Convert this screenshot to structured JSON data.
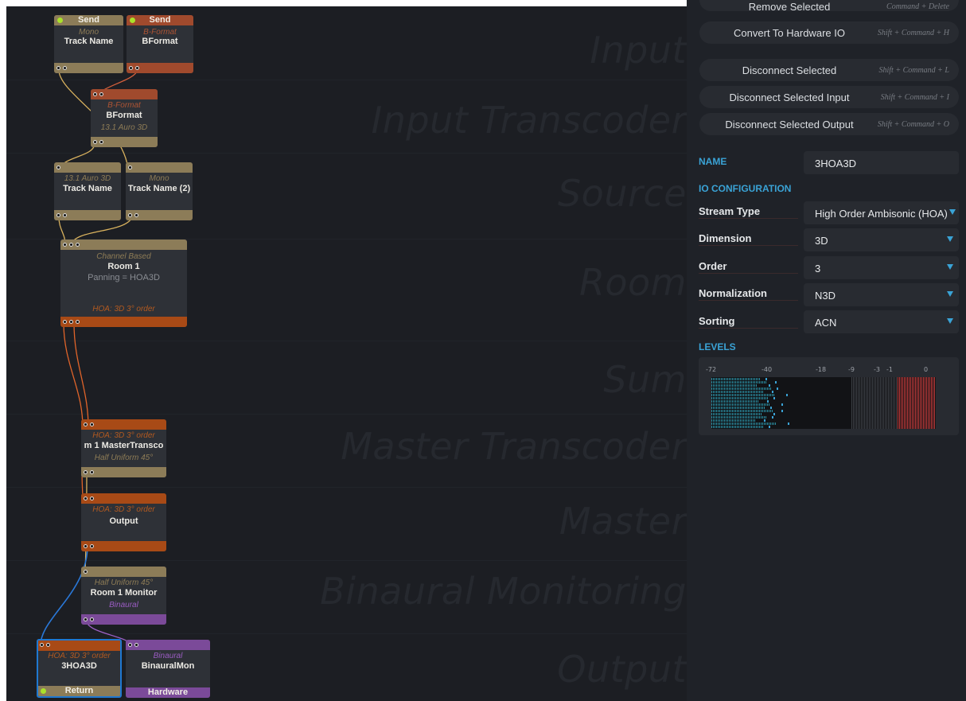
{
  "stages": [
    "Input",
    "Input Transcoder",
    "Source",
    "Room",
    "Sum",
    "Master Transcoder",
    "Master",
    "Binaural Monitoring",
    "Output"
  ],
  "nodes": {
    "send_mono": {
      "header": "Send",
      "format": "Mono",
      "name": "Track Name"
    },
    "send_bformat": {
      "header": "Send",
      "format": "B-Format",
      "name": "BFormat"
    },
    "bformat_transcoder": {
      "format": "B-Format",
      "name": "BFormat",
      "output_format": "13.1 Auro 3D"
    },
    "track_auro": {
      "format": "13.1 Auro 3D",
      "name": "Track Name"
    },
    "track_mono2": {
      "format": "Mono",
      "name": "Track Name (2)"
    },
    "room1": {
      "format": "Channel Based",
      "name": "Room 1",
      "info": "Panning = HOA3D",
      "output_format": "HOA: 3D 3° order"
    },
    "master_transcoder": {
      "format": "HOA: 3D 3° order",
      "name": "m 1 MasterTransco",
      "output_format": "Half Uniform 45°"
    },
    "output": {
      "format": "HOA: 3D 3° order",
      "name": "Output"
    },
    "monitor": {
      "format": "Half Uniform 45°",
      "name": "Room 1 Monitor",
      "output_format": "Binaural"
    },
    "return_3hoa": {
      "format": "HOA: 3D 3° order",
      "name": "3HOA3D",
      "footer": "Return"
    },
    "binauralmon": {
      "format": "Binaural",
      "name": "BinauralMon",
      "footer": "Hardware"
    }
  },
  "panel": {
    "commands": [
      {
        "label": "Remove Selected",
        "shortcut": "Command + Delete"
      },
      {
        "label": "Convert To Hardware IO",
        "shortcut": "Shift + Command + H"
      },
      {
        "label": "Disconnect Selected",
        "shortcut": "Shift + Command + L"
      },
      {
        "label": "Disconnect Selected Input",
        "shortcut": "Shift + Command + I"
      },
      {
        "label": "Disconnect Selected Output",
        "shortcut": "Shift + Command + O"
      }
    ],
    "name_label": "NAME",
    "name_value": "3HOA3D",
    "io_label": "IO CONFIGURATION",
    "fields": [
      {
        "label": "Stream Type",
        "value": "High Order Ambisonic (HOA)"
      },
      {
        "label": "Dimension",
        "value": "3D"
      },
      {
        "label": "Order",
        "value": "3"
      },
      {
        "label": "Normalization",
        "value": "N3D"
      },
      {
        "label": "Sorting",
        "value": "ACN"
      }
    ],
    "levels_label": "LEVELS",
    "meter_ticks": [
      "-72",
      "-40",
      "-18",
      "-9",
      "-3",
      "-1",
      "0"
    ]
  },
  "colors": {
    "canvas_bg": "#1c1e23",
    "panel_bg": "#1f2228",
    "accent_blue": "#3aa3d6",
    "mono_tan": "#8c7c58",
    "bformat_rust": "#a04a2d",
    "hoa_orange": "#a84a16",
    "binaural_purple": "#7b4a99",
    "selected_border": "#1f78d1",
    "active_led": "#a9e22a",
    "meter_clip": "#c23a3a"
  }
}
